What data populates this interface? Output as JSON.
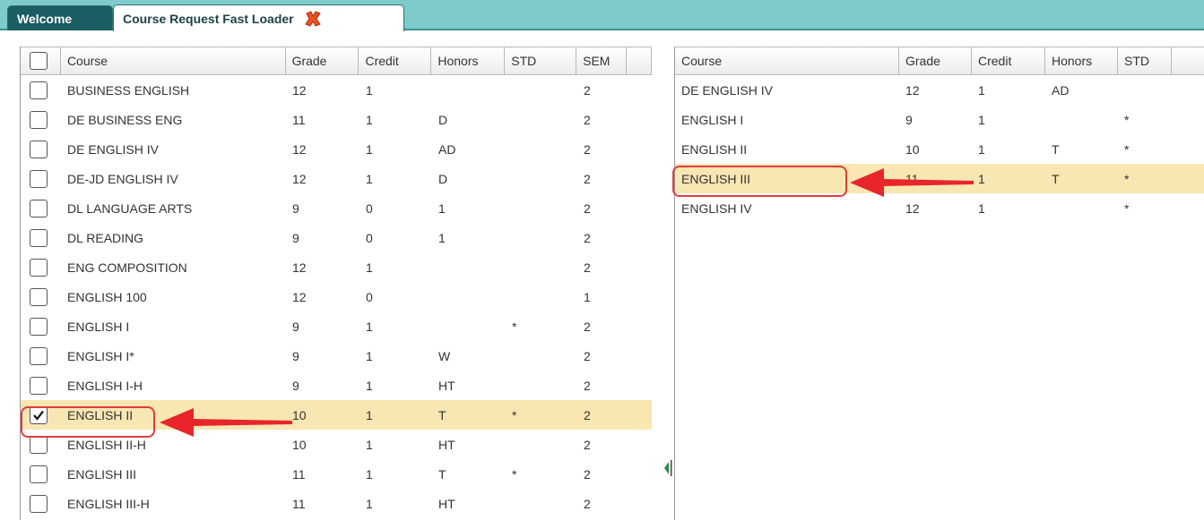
{
  "tabs": {
    "welcome": "Welcome",
    "active": "Course Request Fast Loader"
  },
  "left_table": {
    "headers": {
      "course": "Course",
      "grade": "Grade",
      "credit": "Credit",
      "honors": "Honors",
      "std": "STD",
      "sem": "SEM"
    },
    "rows": [
      {
        "course": "BUSINESS ENGLISH",
        "grade": "12",
        "credit": "1",
        "honors": "",
        "std": "",
        "sem": "2",
        "checked": false
      },
      {
        "course": "DE BUSINESS ENG",
        "grade": "11",
        "credit": "1",
        "honors": "D",
        "std": "",
        "sem": "2",
        "checked": false
      },
      {
        "course": "DE ENGLISH IV",
        "grade": "12",
        "credit": "1",
        "honors": "AD",
        "std": "",
        "sem": "2",
        "checked": false
      },
      {
        "course": "DE-JD ENGLISH IV",
        "grade": "12",
        "credit": "1",
        "honors": "D",
        "std": "",
        "sem": "2",
        "checked": false
      },
      {
        "course": "DL LANGUAGE ARTS",
        "grade": "9",
        "credit": "0",
        "honors": "1",
        "std": "",
        "sem": "2",
        "checked": false
      },
      {
        "course": "DL READING",
        "grade": "9",
        "credit": "0",
        "honors": "1",
        "std": "",
        "sem": "2",
        "checked": false
      },
      {
        "course": "ENG COMPOSITION",
        "grade": "12",
        "credit": "1",
        "honors": "",
        "std": "",
        "sem": "2",
        "checked": false
      },
      {
        "course": "ENGLISH 100",
        "grade": "12",
        "credit": "0",
        "honors": "",
        "std": "",
        "sem": "1",
        "checked": false
      },
      {
        "course": "ENGLISH I",
        "grade": "9",
        "credit": "1",
        "honors": "",
        "std": "*",
        "sem": "2",
        "checked": false
      },
      {
        "course": "ENGLISH I*",
        "grade": "9",
        "credit": "1",
        "honors": "W",
        "std": "",
        "sem": "2",
        "checked": false
      },
      {
        "course": "ENGLISH I-H",
        "grade": "9",
        "credit": "1",
        "honors": "HT",
        "std": "",
        "sem": "2",
        "checked": false
      },
      {
        "course": "ENGLISH II",
        "grade": "10",
        "credit": "1",
        "honors": "T",
        "std": "*",
        "sem": "2",
        "checked": true
      },
      {
        "course": "ENGLISH II-H",
        "grade": "10",
        "credit": "1",
        "honors": "HT",
        "std": "",
        "sem": "2",
        "checked": false
      },
      {
        "course": "ENGLISH III",
        "grade": "11",
        "credit": "1",
        "honors": "T",
        "std": "*",
        "sem": "2",
        "checked": false
      },
      {
        "course": "ENGLISH III-H",
        "grade": "11",
        "credit": "1",
        "honors": "HT",
        "std": "",
        "sem": "2",
        "checked": false
      }
    ]
  },
  "right_table": {
    "headers": {
      "course": "Course",
      "grade": "Grade",
      "credit": "Credit",
      "honors": "Honors",
      "std": "STD"
    },
    "rows": [
      {
        "course": "DE ENGLISH IV",
        "grade": "12",
        "credit": "1",
        "honors": "AD",
        "std": ""
      },
      {
        "course": "ENGLISH I",
        "grade": "9",
        "credit": "1",
        "honors": "",
        "std": "*"
      },
      {
        "course": "ENGLISH II",
        "grade": "10",
        "credit": "1",
        "honors": "T",
        "std": "*"
      },
      {
        "course": "ENGLISH III",
        "grade": "11",
        "credit": "1",
        "honors": "T",
        "std": "*"
      },
      {
        "course": "ENGLISH IV",
        "grade": "12",
        "credit": "1",
        "honors": "",
        "std": "*"
      }
    ]
  },
  "colors": {
    "tabbar": "#7fcaca",
    "welcome_tab": "#1b5d63",
    "selected_row": "#f8e6b3",
    "callout": "#e23b3b"
  },
  "icons": {
    "close": "close-x-icon",
    "check": "checkmark-icon",
    "splitter": "collapse-left-icon"
  }
}
